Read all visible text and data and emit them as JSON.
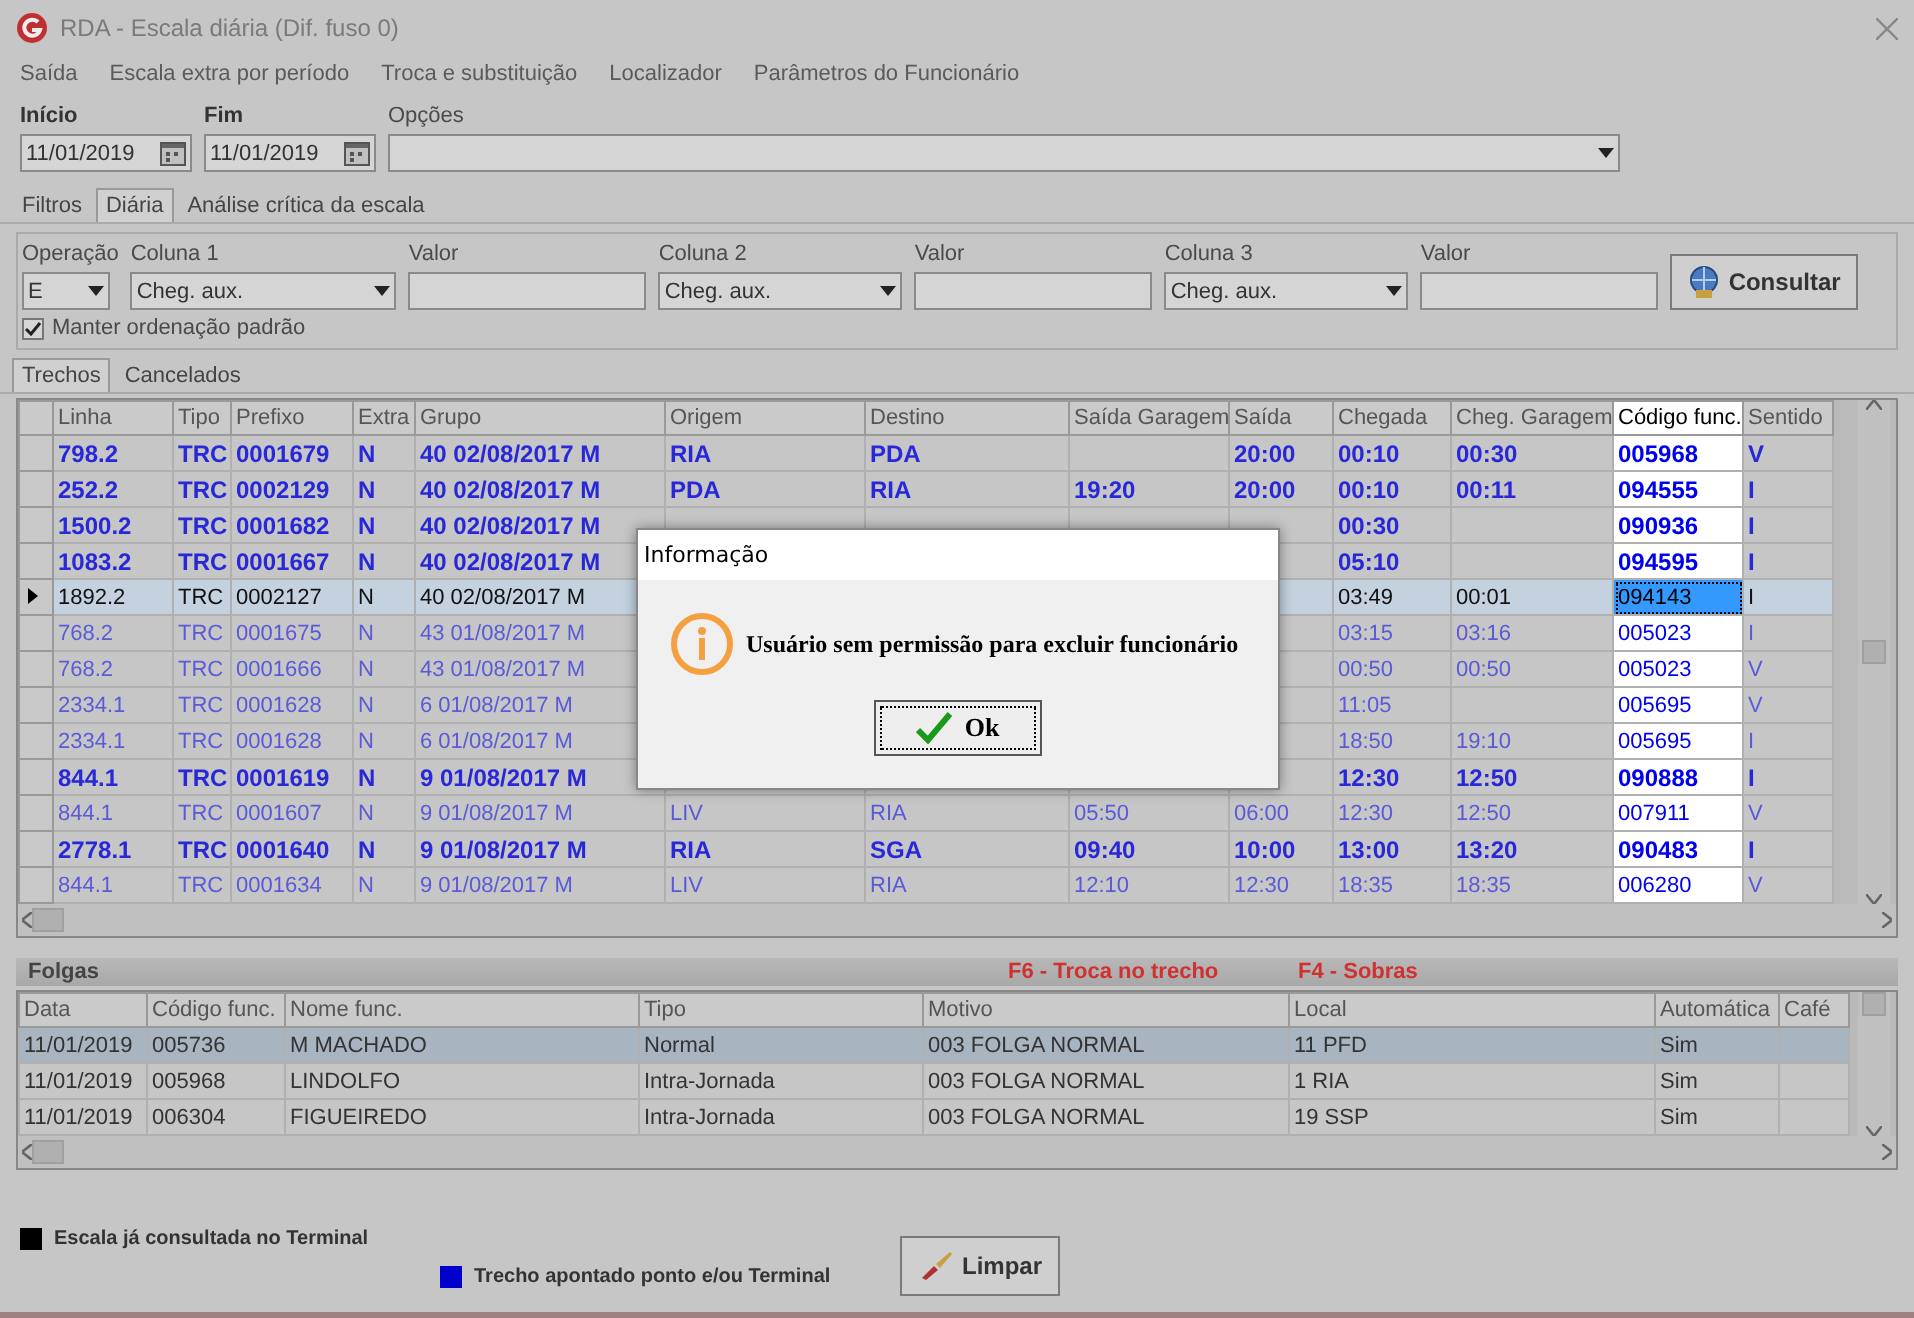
{
  "window": {
    "title": "RDA - Escala diária (Dif. fuso 0)"
  },
  "menu": [
    "Saída",
    "Escala extra por período",
    "Troca e substituição",
    "Localizador",
    "Parâmetros do Funcionário"
  ],
  "period": {
    "start_label": "Início",
    "start": "11/01/2019",
    "end_label": "Fim",
    "end": "11/01/2019",
    "options_label": "Opções"
  },
  "tabs": [
    {
      "label": "Filtros",
      "selected": false
    },
    {
      "label": "Diária",
      "selected": true
    },
    {
      "label": "Análise crítica da escala",
      "selected": false
    }
  ],
  "filters": {
    "operation_label": "Operação",
    "operation": "E",
    "columns": [
      {
        "label": "Coluna 1",
        "value": "Cheg. aux.",
        "value_label": "Valor"
      },
      {
        "label": "Coluna 2",
        "value": "Cheg. aux.",
        "value_label": "Valor"
      },
      {
        "label": "Coluna 3",
        "value": "Cheg. aux.",
        "value_label": "Valor"
      }
    ],
    "keep_order": {
      "label": "Manter ordenação padrão",
      "checked": true
    },
    "search_button": "Consultar"
  },
  "subtabs": [
    {
      "label": "Trechos",
      "selected": true
    },
    {
      "label": "Cancelados",
      "selected": false
    }
  ],
  "trechos": {
    "columns": [
      {
        "label": "Linha",
        "selected": false
      },
      {
        "label": "Tipo",
        "selected": false
      },
      {
        "label": "Prefixo",
        "selected": false
      },
      {
        "label": "Extra",
        "selected": false
      },
      {
        "label": "Grupo",
        "selected": false
      },
      {
        "label": "Origem",
        "selected": false
      },
      {
        "label": "Destino",
        "selected": false
      },
      {
        "label": "Saída Garagem",
        "selected": false
      },
      {
        "label": "Saída",
        "selected": false
      },
      {
        "label": "Chegada",
        "selected": false
      },
      {
        "label": "Cheg. Garagem",
        "selected": false
      },
      {
        "label": "Código func.",
        "selected": true
      },
      {
        "label": "Sentido",
        "selected": false
      }
    ],
    "rows": [
      {
        "selected": false,
        "bold": true,
        "cells": [
          "798.2",
          "TRC",
          "0001679",
          "N",
          "40 02/08/2017 M",
          "RIA",
          "PDA",
          null,
          "20:00",
          "00:10",
          "00:30",
          "005968",
          "V"
        ]
      },
      {
        "selected": false,
        "bold": true,
        "cells": [
          "252.2",
          "TRC",
          "0002129",
          "N",
          "40 02/08/2017 M",
          "PDA",
          "RIA",
          "19:20",
          "20:00",
          "00:10",
          "00:11",
          "094555",
          "I"
        ]
      },
      {
        "selected": false,
        "bold": true,
        "cells": [
          "1500.2",
          "TRC",
          "0001682",
          "N",
          "40 02/08/2017 M",
          null,
          null,
          null,
          null,
          "00:30",
          null,
          "090936",
          "I"
        ]
      },
      {
        "selected": false,
        "bold": true,
        "cells": [
          "1083.2",
          "TRC",
          "0001667",
          "N",
          "40 02/08/2017 M",
          null,
          null,
          null,
          null,
          "05:10",
          null,
          "094595",
          "I"
        ]
      },
      {
        "selected": true,
        "bold": false,
        "cells": [
          "1892.2",
          "TRC",
          "0002127",
          "N",
          "40 02/08/2017 M",
          null,
          null,
          null,
          null,
          "03:49",
          "00:01",
          "094143",
          "I"
        ]
      },
      {
        "selected": false,
        "bold": false,
        "cells": [
          "768.2",
          "TRC",
          "0001675",
          "N",
          "43 01/08/2017 M",
          null,
          null,
          null,
          null,
          "03:15",
          "03:16",
          "005023",
          "I"
        ]
      },
      {
        "selected": false,
        "bold": false,
        "cells": [
          "768.2",
          "TRC",
          "0001666",
          "N",
          "43 01/08/2017 M",
          null,
          null,
          null,
          null,
          "00:50",
          "00:50",
          "005023",
          "V"
        ]
      },
      {
        "selected": false,
        "bold": false,
        "cells": [
          "2334.1",
          "TRC",
          "0001628",
          "N",
          "6 01/08/2017 M",
          null,
          null,
          null,
          null,
          "11:05",
          null,
          "005695",
          "V"
        ]
      },
      {
        "selected": false,
        "bold": false,
        "cells": [
          "2334.1",
          "TRC",
          "0001628",
          "N",
          "6 01/08/2017 M",
          null,
          null,
          null,
          null,
          "18:50",
          "19:10",
          "005695",
          "I"
        ]
      },
      {
        "selected": false,
        "bold": true,
        "cells": [
          "844.1",
          "TRC",
          "0001619",
          "N",
          "9 01/08/2017 M",
          null,
          null,
          null,
          null,
          "12:30",
          "12:50",
          "090888",
          "I"
        ]
      },
      {
        "selected": false,
        "bold": false,
        "cells": [
          "844.1",
          "TRC",
          "0001607",
          "N",
          "9 01/08/2017 M",
          "LIV",
          "RIA",
          "05:50",
          "06:00",
          "12:30",
          "12:50",
          "007911",
          "V"
        ]
      },
      {
        "selected": false,
        "bold": true,
        "cells": [
          "2778.1",
          "TRC",
          "0001640",
          "N",
          "9 01/08/2017 M",
          "RIA",
          "SGA",
          "09:40",
          "10:00",
          "13:00",
          "13:20",
          "090483",
          "I"
        ]
      },
      {
        "selected": false,
        "bold": false,
        "cells": [
          "844.1",
          "TRC",
          "0001634",
          "N",
          "9 01/08/2017 M",
          "LIV",
          "RIA",
          "12:10",
          "12:30",
          "18:35",
          "18:35",
          "006280",
          "V"
        ]
      }
    ]
  },
  "folgas": {
    "title": "Folgas",
    "hints": [
      "F6 - Troca no trecho",
      "F4 - Sobras"
    ],
    "columns": [
      "Data",
      "Código func.",
      "Nome func.",
      "Tipo",
      "Motivo",
      "Local",
      "Automática",
      "Café"
    ],
    "rows": [
      {
        "selected": true,
        "cells": [
          "11/01/2019",
          "005736",
          "M MACHADO",
          "Normal",
          "003 FOLGA NORMAL",
          "11 PFD",
          "Sim"
        ]
      },
      {
        "selected": false,
        "cells": [
          "11/01/2019",
          "005968",
          "LINDOLFO",
          "Intra-Jornada",
          "003 FOLGA NORMAL",
          "1 RIA",
          "Sim"
        ]
      },
      {
        "selected": false,
        "cells": [
          "11/01/2019",
          "006304",
          "FIGUEIREDO",
          "Intra-Jornada",
          "003 FOLGA NORMAL",
          "19 SSP",
          "Sim"
        ]
      }
    ]
  },
  "legend": [
    {
      "label": "Escala já consultada no Terminal",
      "color": "#000000"
    },
    {
      "label": "Trecho apontado ponto e/ou Terminal",
      "color": "#0000cc"
    }
  ],
  "clear_button": "Limpar",
  "dialog": {
    "title": "Informação",
    "message": "Usuário sem permissão para excluir funcionário",
    "button": "Ok"
  }
}
